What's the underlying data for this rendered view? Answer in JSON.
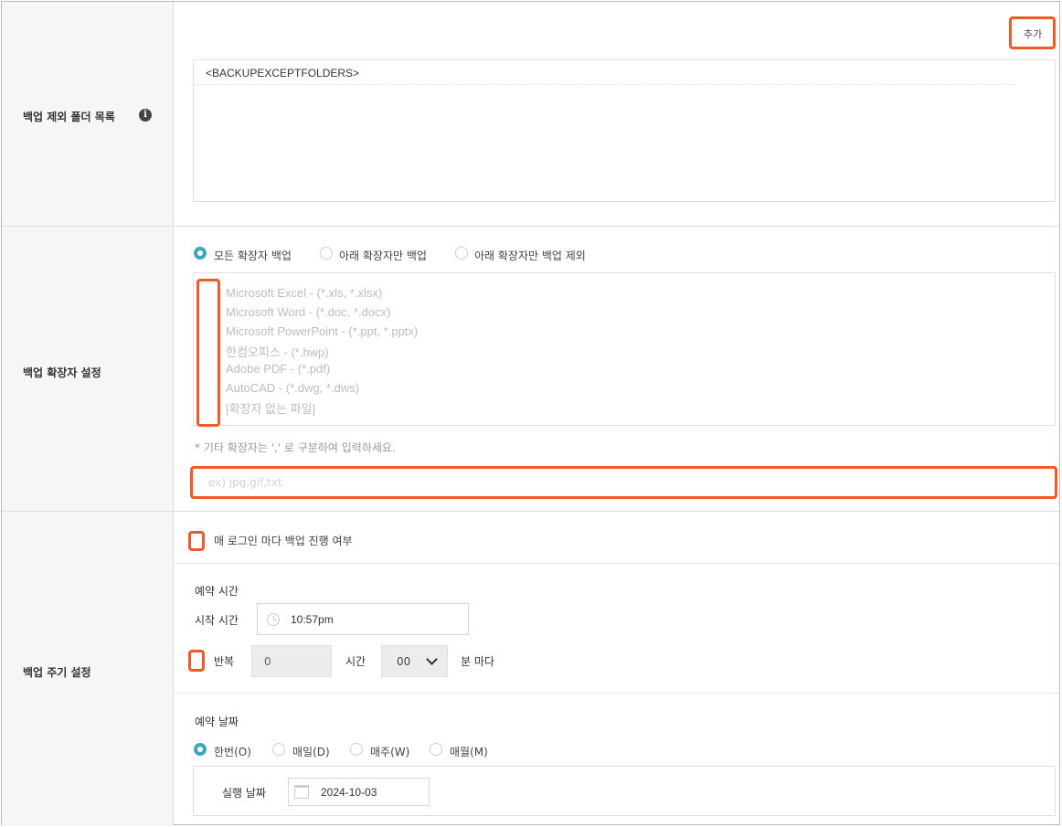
{
  "exclude": {
    "label": "백업 제외 폴더 목록",
    "add_button": "추가",
    "folders": [
      "<BACKUPEXCEPTFOLDERS>"
    ]
  },
  "extension": {
    "label": "백업 확장자 설정",
    "radios": [
      {
        "label": "모든 확장자 백업",
        "checked": true
      },
      {
        "label": "아래 확장자만 백업",
        "checked": false
      },
      {
        "label": "아래 확장자만 백업 제외",
        "checked": false
      }
    ],
    "types": [
      "Microsoft Excel - (*.xls, *.xlsx)",
      "Microsoft Word - (*.doc, *.docx)",
      "Microsoft PowerPoint - (*.ppt, *.pptx)",
      "한컴오피스 - (*.hwp)",
      "Adobe PDF - (*.pdf)",
      "AutoCAD - (*.dwg, *.dws)",
      "[확장자 없는 파일]"
    ],
    "note": "* 기타 확장자는 ',' 로 구분하여 입력하세요.",
    "input_placeholder": "ex) jpg,gif,txt"
  },
  "cycle": {
    "label": "백업 주기 설정",
    "every_login_label": "매 로그인 마다 백업 진행 여부",
    "schedule_time_title": "예약 시간",
    "start_time_label": "시작 시간",
    "start_time_value": "10:57pm",
    "repeat_label": "반복",
    "repeat_hours_value": "0",
    "hour_label": "시간",
    "minute_value": "00",
    "minute_suffix": "분 마다",
    "schedule_date_title": "예약 날짜",
    "date_radios": [
      {
        "label": "한번(O)",
        "checked": true
      },
      {
        "label": "매일(D)",
        "checked": false
      },
      {
        "label": "매주(W)",
        "checked": false
      },
      {
        "label": "매월(M)",
        "checked": false
      }
    ],
    "run_date_label": "실행 날짜",
    "run_date_value": "2024-10-03"
  },
  "colors": {
    "highlight": "#f05a28",
    "radio_active": "#3fa5b7",
    "label_bg": "#f6f6f6"
  }
}
